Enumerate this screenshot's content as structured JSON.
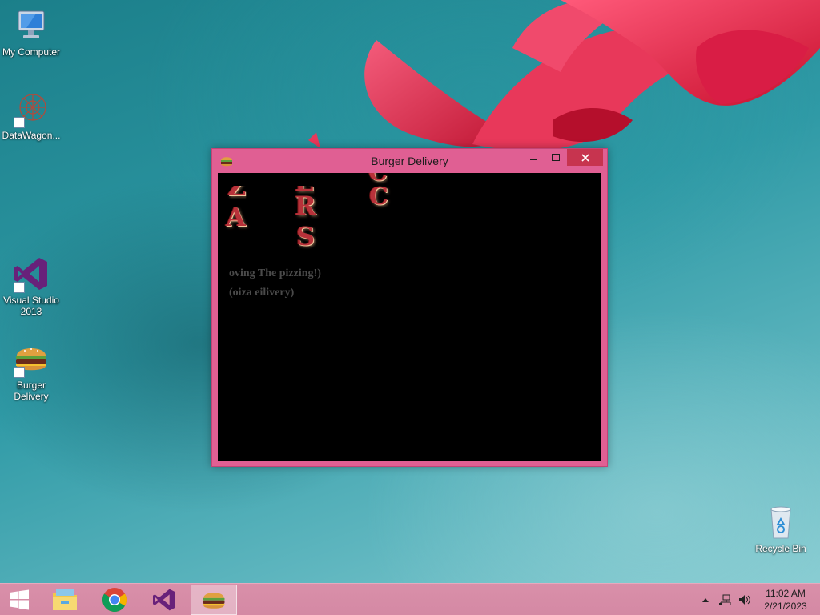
{
  "desktop": {
    "icons": [
      {
        "label": "My Computer"
      },
      {
        "label": "DataWagon..."
      },
      {
        "label": "Visual Studio 2013"
      },
      {
        "label": "Burger Delivery"
      },
      {
        "label": "Recycle Bin"
      }
    ]
  },
  "window": {
    "title": "Burger Delivery",
    "icon": "burger-icon",
    "scroll_letters": [
      "Z",
      "E",
      "C",
      "A",
      "R",
      "C",
      "S"
    ],
    "line1": "oving The pizzing!)",
    "line2": "(oiza eilivery)"
  },
  "taskbar": {
    "items": [
      "start-icon",
      "file-explorer-icon",
      "chrome-icon",
      "visual-studio-icon",
      "burger-icon"
    ],
    "clock_time": "11:02 AM",
    "clock_date": "2/21/2023"
  },
  "colors": {
    "window_frame": "#e05f93",
    "taskbar": "#d98fa9",
    "close_button": "#c7344f"
  }
}
